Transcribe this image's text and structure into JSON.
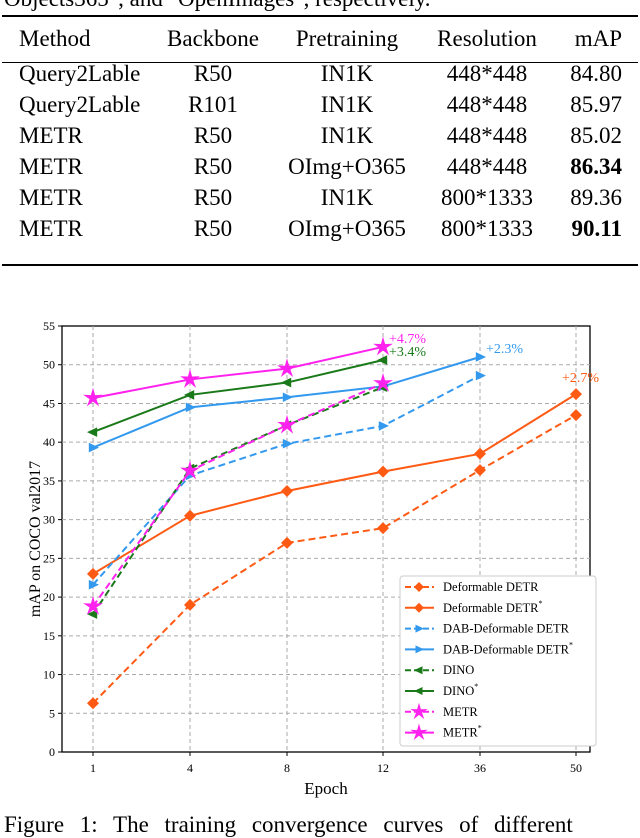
{
  "top_text": "Objects365\", and \"OpenImages\", respectively.",
  "table": {
    "headers": [
      "Method",
      "Backbone",
      "Pretraining",
      "Resolution",
      "mAP"
    ],
    "rows": [
      {
        "cells": [
          "Query2Lable",
          "R50",
          "IN1K",
          "448*448",
          "84.80"
        ],
        "bold": false
      },
      {
        "cells": [
          "Query2Lable",
          "R101",
          "IN1K",
          "448*448",
          "85.97"
        ],
        "bold": false
      },
      {
        "cells": [
          "METR",
          "R50",
          "IN1K",
          "448*448",
          "85.02"
        ],
        "bold": false
      },
      {
        "cells": [
          "METR",
          "R50",
          "OImg+O365",
          "448*448",
          "86.34"
        ],
        "bold": true
      },
      {
        "cells": [
          "METR",
          "R50",
          "IN1K",
          "800*1333",
          "89.36"
        ],
        "bold": false
      },
      {
        "cells": [
          "METR",
          "R50",
          "OImg+O365",
          "800*1333",
          "90.11"
        ],
        "bold": true
      }
    ]
  },
  "chart_data": {
    "type": "line",
    "xlabel": "Epoch",
    "ylabel": "mAP on COCO val2017",
    "categories": [
      "1",
      "4",
      "8",
      "12",
      "36",
      "50"
    ],
    "ylim": [
      0,
      55
    ],
    "yticks": [
      0,
      5,
      10,
      15,
      20,
      25,
      30,
      35,
      40,
      45,
      50,
      55
    ],
    "grid": true,
    "legend_position": "bottom-right",
    "series": [
      {
        "name": "Deformable DETR",
        "sup": "",
        "color": "#ff5a14",
        "dash": true,
        "marker": "diamond",
        "values": [
          6.3,
          19.0,
          27.0,
          28.9,
          36.4,
          43.5
        ]
      },
      {
        "name": "Deformable DETR",
        "sup": "*",
        "color": "#ff5a14",
        "dash": false,
        "marker": "diamond",
        "values": [
          23.0,
          30.5,
          33.7,
          36.2,
          38.5,
          46.2
        ]
      },
      {
        "name": "DAB-Deformable DETR",
        "sup": "",
        "color": "#3399ee",
        "dash": true,
        "marker": "triangle-right",
        "values": [
          21.6,
          35.7,
          39.8,
          42.1,
          48.6,
          null
        ]
      },
      {
        "name": "DAB-Deformable DETR",
        "sup": "*",
        "color": "#3399ee",
        "dash": false,
        "marker": "triangle-right",
        "values": [
          39.3,
          44.5,
          45.8,
          47.2,
          51.0,
          null
        ]
      },
      {
        "name": "DINO",
        "sup": "",
        "color": "#1a7a1a",
        "dash": true,
        "marker": "triangle-left",
        "values": [
          17.8,
          36.6,
          42.2,
          47.1,
          null,
          null
        ]
      },
      {
        "name": "DINO",
        "sup": "*",
        "color": "#1a7a1a",
        "dash": false,
        "marker": "triangle-left",
        "values": [
          41.3,
          46.1,
          47.7,
          50.6,
          null,
          null
        ]
      },
      {
        "name": "METR",
        "sup": "",
        "color": "#ff22ee",
        "dash": true,
        "marker": "star",
        "values": [
          18.8,
          36.3,
          42.2,
          47.6,
          null,
          null
        ]
      },
      {
        "name": "METR",
        "sup": "*",
        "color": "#ff22ee",
        "dash": false,
        "marker": "star",
        "values": [
          45.7,
          48.1,
          49.5,
          52.3,
          null,
          null
        ]
      }
    ],
    "annotations": [
      {
        "text": "+4.7%",
        "series": 7,
        "color": "#ff22ee"
      },
      {
        "text": "+3.4%",
        "series": 5,
        "color": "#1a7a1a"
      },
      {
        "text": "+2.3%",
        "series": 3,
        "color": "#3399ee"
      },
      {
        "text": "+2.7%",
        "series": 1,
        "color": "#ff5a14"
      }
    ]
  },
  "caption": "Figure 1: The training convergence curves of different"
}
